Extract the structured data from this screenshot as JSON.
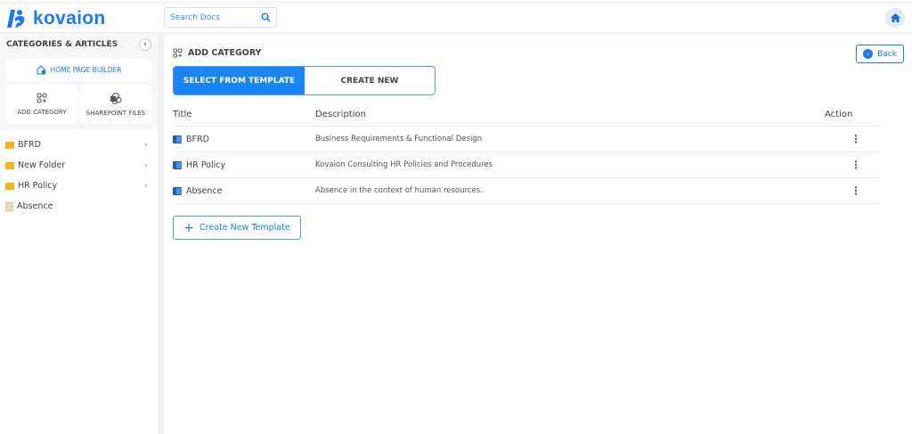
{
  "header": {
    "logo": "kovaion",
    "search_placeholder": "Search Docs"
  },
  "sidebar": {
    "title": "CATEGORIES & ARTICLES",
    "home_page_builder": "HOME PAGE BUILDER",
    "add_category": "ADD CATEGORY",
    "sharepoint_files": "SHAREPOINT FILES",
    "items": [
      {
        "label": "BFRD",
        "type": "folder"
      },
      {
        "label": "New Folder",
        "type": "folder"
      },
      {
        "label": "HR Policy",
        "type": "folder"
      },
      {
        "label": "Absence",
        "type": "article"
      }
    ]
  },
  "main": {
    "heading": "ADD CATEGORY",
    "back_label": "Back",
    "tabs": [
      {
        "label": "SELECT FROM TEMPLATE",
        "active": true
      },
      {
        "label": "CREATE NEW",
        "active": false
      }
    ],
    "columns": [
      "Title",
      "Description",
      "Action"
    ],
    "rows": [
      {
        "title": "BFRD",
        "description": "Business Requirements & Functional Design"
      },
      {
        "title": "HR Policy",
        "description": "Kovaion Consulting HR Policies and Procedures"
      },
      {
        "title": "Absence",
        "description": "Absence in the context of human resources."
      }
    ],
    "create_template_label": "Create New Template"
  },
  "colors": {
    "accent": "#1a84f5"
  }
}
